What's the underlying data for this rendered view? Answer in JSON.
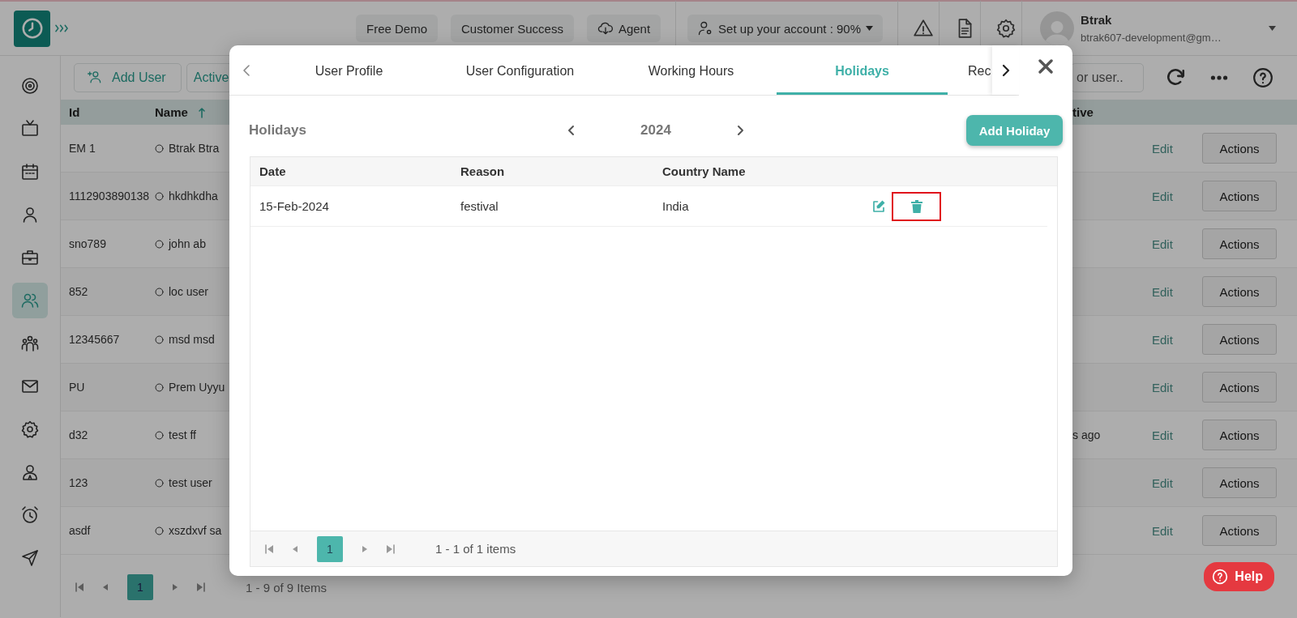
{
  "header": {
    "buttons": [
      {
        "label": "Free Demo",
        "kind": "plain"
      },
      {
        "label": "Customer Success",
        "kind": "plain"
      },
      {
        "label": "Agent",
        "kind": "download"
      }
    ],
    "setup": {
      "label": "Set up your account : 90%"
    },
    "user": {
      "name": "Btrak",
      "email": "btrak607-development@gm…"
    }
  },
  "sidebar": {
    "items": [
      {
        "selected": false
      },
      {
        "selected": false
      },
      {
        "selected": false
      },
      {
        "selected": false
      },
      {
        "selected": false
      },
      {
        "selected": true
      },
      {
        "selected": false
      },
      {
        "selected": false
      },
      {
        "selected": false
      },
      {
        "selected": false
      },
      {
        "selected": false
      },
      {
        "selected": false
      }
    ]
  },
  "toolbar": {
    "add_user": "Add User",
    "filter": "Active",
    "search": {
      "placeholder": "or user.."
    }
  },
  "table": {
    "columns": [
      "Id",
      "Name",
      "tive"
    ],
    "rows": [
      {
        "id": "EM 1",
        "name": "Btrak Btra",
        "edit": "Edit",
        "action": "Actions"
      },
      {
        "id": "1112903890138",
        "name": "hkdhkdha",
        "edit": "Edit",
        "action": "Actions"
      },
      {
        "id": "sno789",
        "name": "john ab",
        "edit": "Edit",
        "action": "Actions"
      },
      {
        "id": "852",
        "name": "loc user",
        "edit": "Edit",
        "action": "Actions"
      },
      {
        "id": "12345667",
        "name": "msd msd",
        "edit": "Edit",
        "action": "Actions"
      },
      {
        "id": "PU",
        "name": "Prem Uyyu",
        "edit": "Edit",
        "action": "Actions"
      },
      {
        "id": "d32",
        "name": "test ff",
        "column_3": "s ago",
        "edit": "Edit",
        "action": "Actions"
      },
      {
        "id": "123",
        "name": "test user",
        "edit": "Edit",
        "action": "Actions"
      },
      {
        "id": "asdf",
        "name": "xszdxvf sa",
        "edit": "Edit",
        "action": "Actions"
      }
    ]
  },
  "pager": {
    "page": "1",
    "summary": "1 - 9 of 9 Items"
  },
  "help": {
    "label": "Help"
  },
  "modal": {
    "tabs": [
      {
        "label": "User Profile",
        "selected": false
      },
      {
        "label": "User Configuration",
        "selected": false
      },
      {
        "label": "Working Hours",
        "selected": false
      },
      {
        "label": "Holidays",
        "selected": true
      },
      {
        "label": "Rec",
        "selected": false
      }
    ],
    "title": "Holidays",
    "year": "2024",
    "add_button": "Add Holiday",
    "columns": [
      "Date",
      "Reason",
      "Country Name"
    ],
    "rows": [
      {
        "date": "15-Feb-2024",
        "reason": "festival",
        "country": "India",
        "delete_highlighted": true
      }
    ],
    "pager": {
      "page": "1",
      "summary": "1 - 1 of 1 items"
    }
  }
}
